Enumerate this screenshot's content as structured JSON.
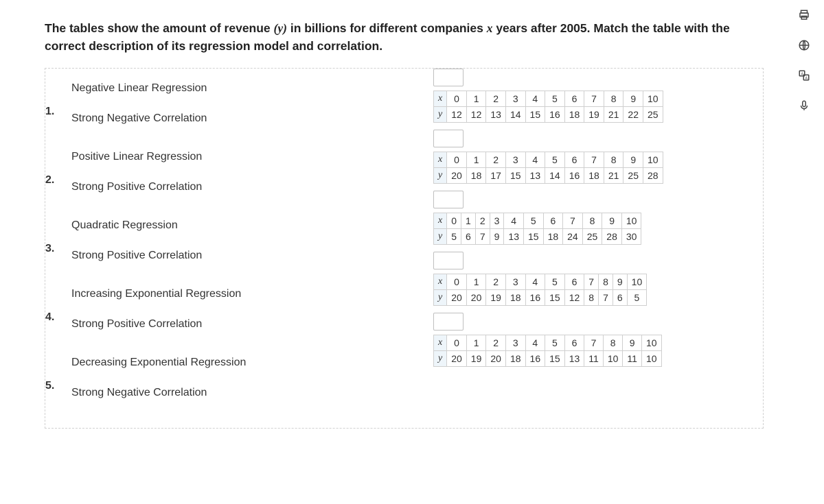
{
  "prompt_before_y": "The tables show the amount of revenue ",
  "prompt_y": "(y)",
  "prompt_mid": " in billions for different companies ",
  "prompt_x": "x",
  "prompt_after_x": " years after 2005. Match the table with the correct description of its regression model and correlation.",
  "descriptions": [
    {
      "num": "1.",
      "line1": "Negative Linear Regression",
      "line2": "Strong Negative Correlation"
    },
    {
      "num": "2.",
      "line1": "Positive Linear Regression",
      "line2": "Strong Positive Correlation"
    },
    {
      "num": "3.",
      "line1": "Quadratic Regression",
      "line2": "Strong Positive Correlation"
    },
    {
      "num": "4.",
      "line1": "Increasing Exponential Regression",
      "line2": "Strong Positive Correlation"
    },
    {
      "num": "5.",
      "line1": "Decreasing Exponential Regression",
      "line2": "Strong Negative Correlation"
    }
  ],
  "tables": [
    {
      "x": [
        "0",
        "1",
        "2",
        "3",
        "4",
        "5",
        "6",
        "7",
        "8",
        "9",
        "10"
      ],
      "y": [
        "12",
        "12",
        "13",
        "14",
        "15",
        "16",
        "18",
        "19",
        "21",
        "22",
        "25"
      ]
    },
    {
      "x": [
        "0",
        "1",
        "2",
        "3",
        "4",
        "5",
        "6",
        "7",
        "8",
        "9",
        "10"
      ],
      "y": [
        "20",
        "18",
        "17",
        "15",
        "13",
        "14",
        "16",
        "18",
        "21",
        "25",
        "28"
      ]
    },
    {
      "x": [
        "0",
        "1",
        "2",
        "3",
        "4",
        "5",
        "6",
        "7",
        "8",
        "9",
        "10"
      ],
      "y": [
        "5",
        "6",
        "7",
        "9",
        "13",
        "15",
        "18",
        "24",
        "25",
        "28",
        "30"
      ]
    },
    {
      "x": [
        "0",
        "1",
        "2",
        "3",
        "4",
        "5",
        "6",
        "7",
        "8",
        "9",
        "10"
      ],
      "y": [
        "20",
        "20",
        "19",
        "18",
        "16",
        "15",
        "12",
        "8",
        "7",
        "6",
        "5"
      ]
    },
    {
      "x": [
        "0",
        "1",
        "2",
        "3",
        "4",
        "5",
        "6",
        "7",
        "8",
        "9",
        "10"
      ],
      "y": [
        "20",
        "19",
        "20",
        "18",
        "16",
        "15",
        "13",
        "11",
        "10",
        "11",
        "10"
      ]
    }
  ],
  "row_labels": {
    "x": "x",
    "y": "y"
  },
  "sidebar": {
    "print": "print-icon",
    "globe": "globe-icon",
    "translate": "translate-icon",
    "mic": "mic-icon"
  }
}
